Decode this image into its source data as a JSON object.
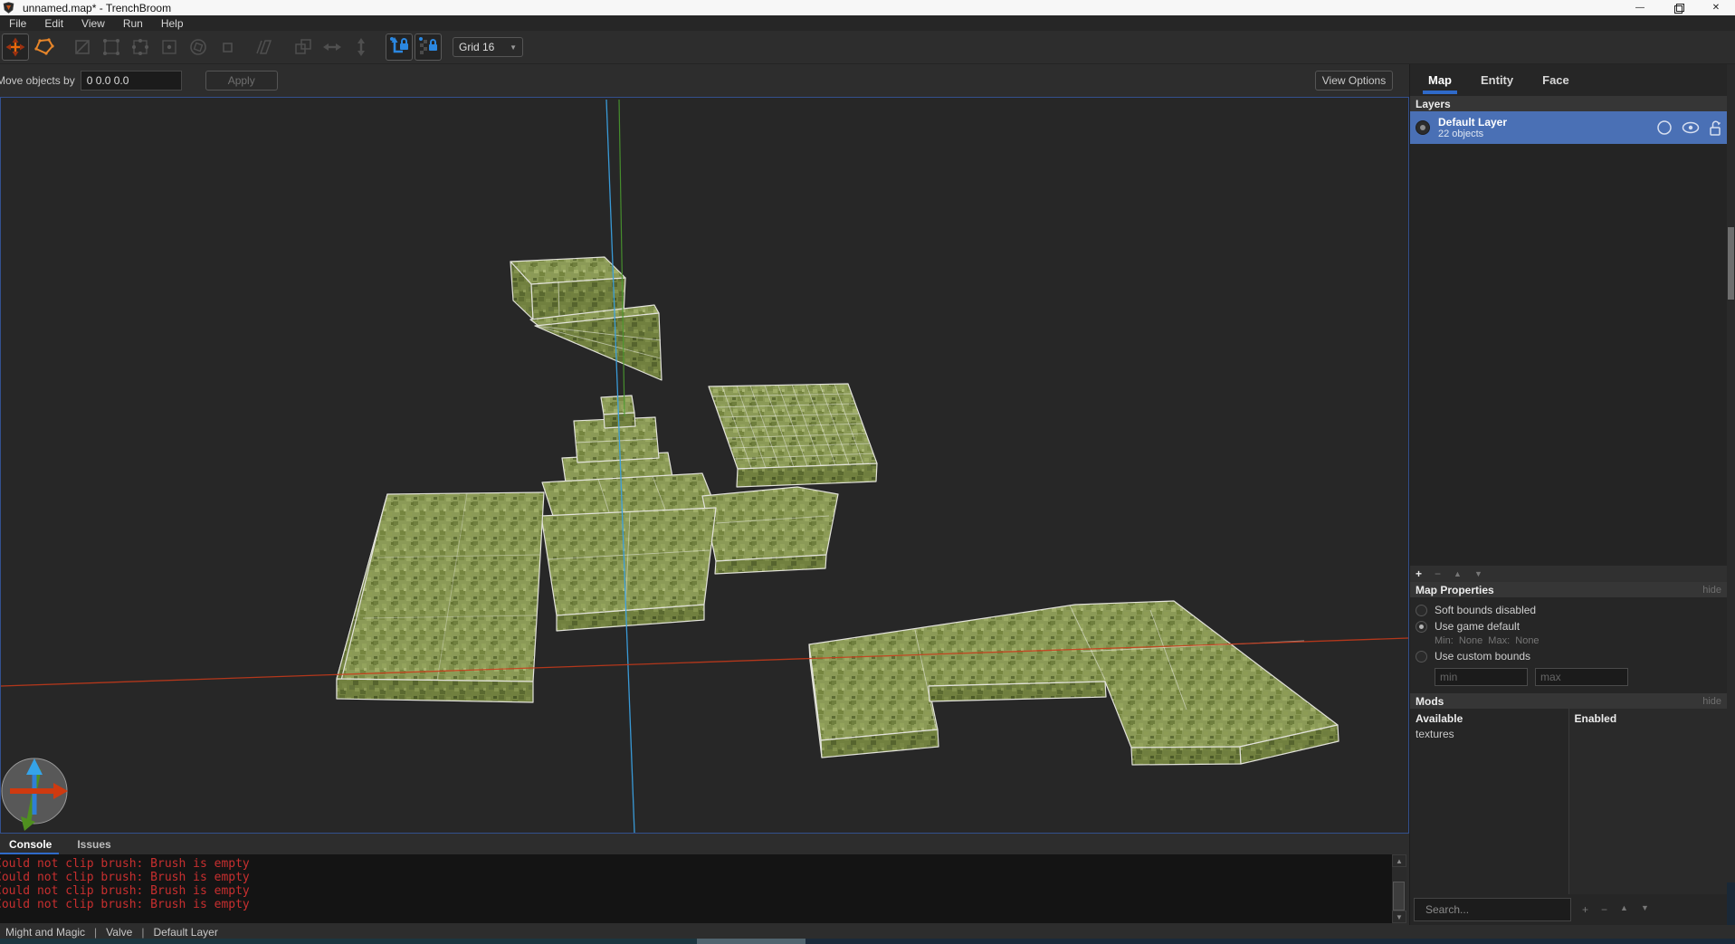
{
  "window": {
    "title": "unnamed.map* - TrenchBroom",
    "controls": {
      "minimize": "—",
      "close": "✕"
    }
  },
  "menu": {
    "items": [
      "File",
      "Edit",
      "View",
      "Run",
      "Help"
    ]
  },
  "toolbar": {
    "grid_label": "Grid 16",
    "icons": [
      "selection-tool",
      "create-brush-tool",
      "clip-tool",
      "vertex-tool",
      "edge-tool",
      "face-tool",
      "rotate-tool",
      "scale-tool",
      "shear-tool",
      "csg-tool",
      "flip-horizontal",
      "flip-vertical",
      "texture-lock",
      "uv-lock"
    ]
  },
  "infobar": {
    "label": "Move objects by",
    "value": "0 0.0 0.0",
    "apply_label": "Apply",
    "view_options_label": "View Options"
  },
  "panel": {
    "tabs": {
      "map": "Map",
      "entity": "Entity",
      "face": "Face"
    },
    "layers": {
      "header": "Layers",
      "selected_name": "Default Layer",
      "selected_count": "22 objects"
    },
    "map_properties": {
      "header": "Map Properties",
      "hide_label": "hide",
      "opt_disabled": "Soft bounds disabled",
      "opt_game_default": "Use game default",
      "min_max": "Min:  None  Max:  None",
      "opt_custom": "Use custom bounds",
      "min_placeholder": "min",
      "max_placeholder": "max"
    },
    "mods": {
      "header": "Mods",
      "hide_label": "hide",
      "available_header": "Available",
      "enabled_header": "Enabled",
      "available_items": [
        "textures"
      ],
      "search_placeholder": "Search..."
    }
  },
  "ui": {
    "plus": "+",
    "minus": "−",
    "up": "▲",
    "down": "▼"
  },
  "console": {
    "tab_console": "Console",
    "tab_issues": "Issues",
    "lines": [
      "Could not clip brush: Brush is empty",
      "Could not clip brush: Brush is empty",
      "Could not clip brush: Brush is empty",
      "Could not clip brush: Brush is empty"
    ]
  },
  "statusbar": {
    "segments": [
      "Might and Magic",
      "Valve",
      "Default Layer"
    ],
    "sep": "|"
  },
  "colors": {
    "accent_blue": "#2f6ac9",
    "selected_layer_blue": "#4a70b5",
    "console_error_red": "#c82f2f",
    "tool_orange": "#e8690c",
    "lock_blue": "#2b87e0",
    "grass_green": "#8b9a57",
    "axis_x_red": "#cc3a1a",
    "axis_y_green": "#4a9a2e",
    "axis_z_blue": "#3aa0e0"
  }
}
